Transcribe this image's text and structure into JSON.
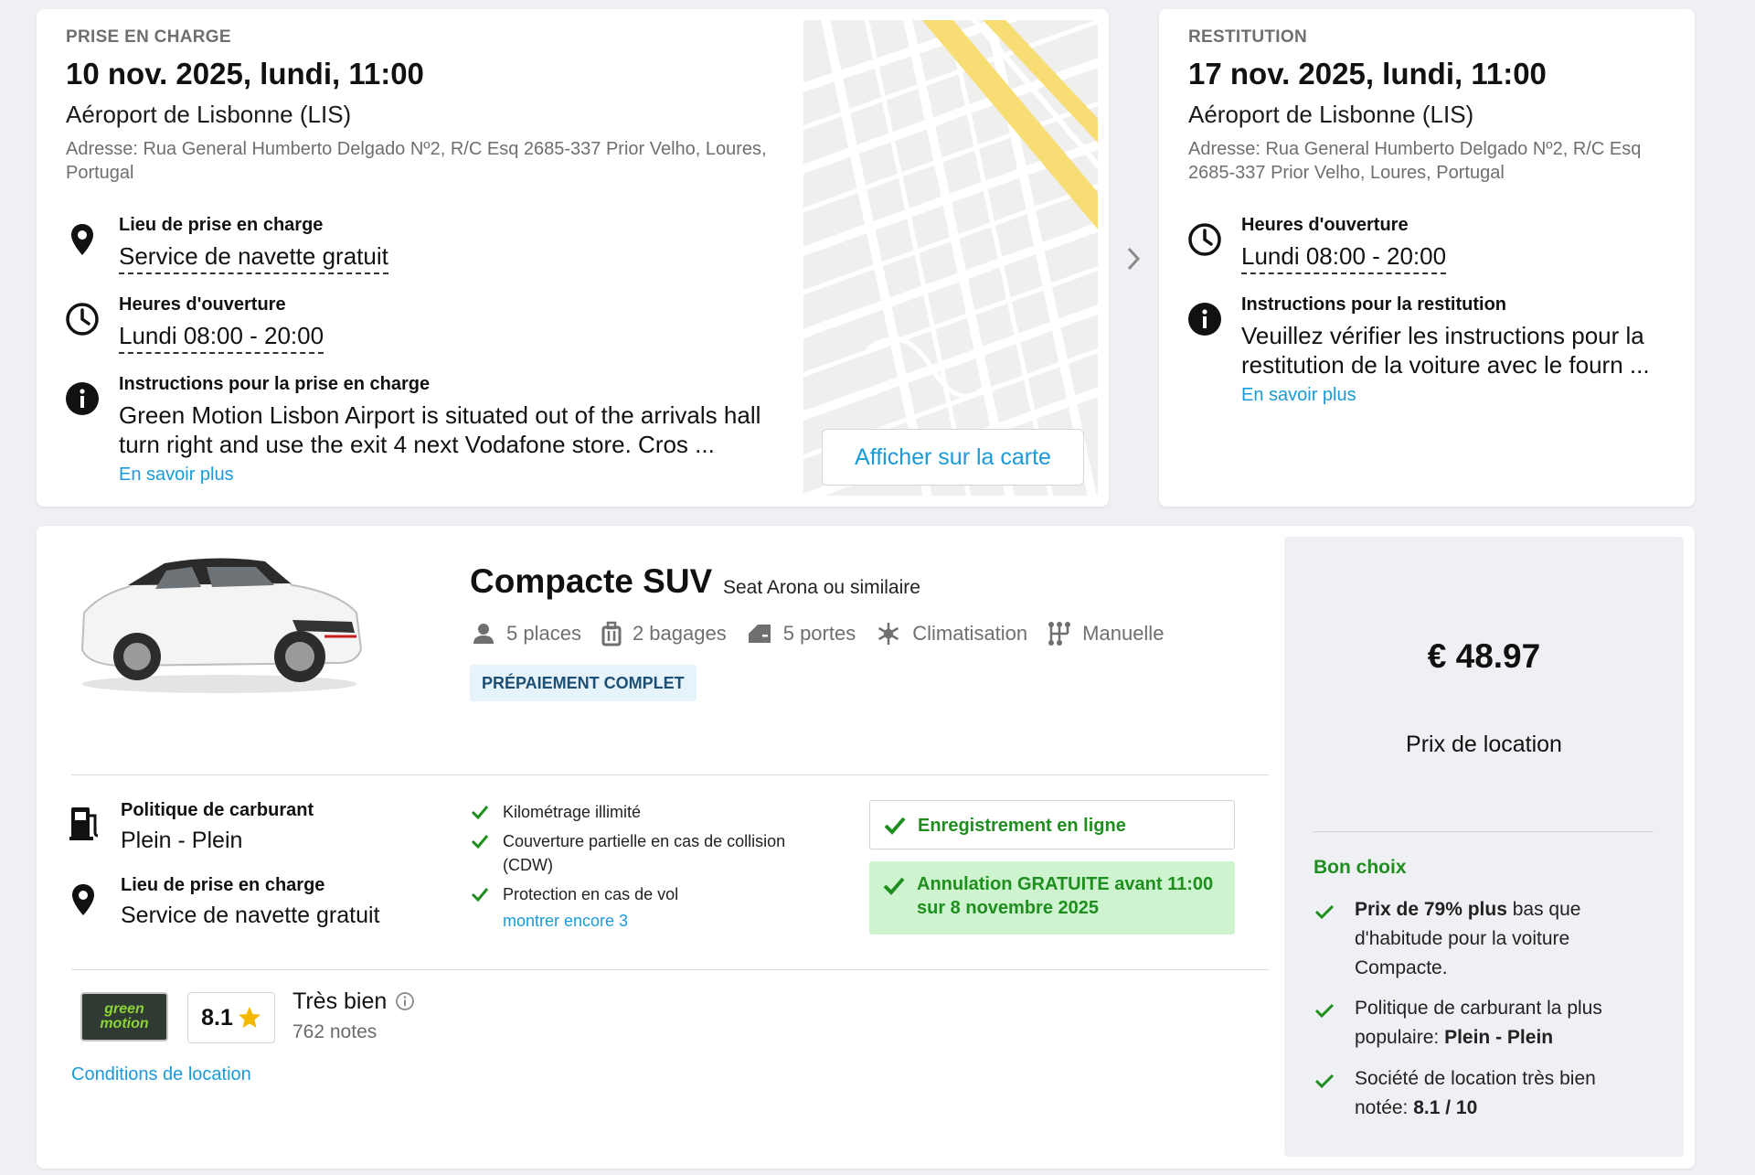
{
  "pickup": {
    "header": "PRISE EN CHARGE",
    "date": "10 nov. 2025, lundi, 11:00",
    "location": "Aéroport de Lisbonne (LIS)",
    "address_line1": "Adresse: Rua General Humberto Delgado Nº2, R/C Esq 2685-337 Prior Velho, Loures,",
    "address_line2": "Portugal",
    "place_label": "Lieu de prise en charge",
    "place_value": "Service de navette gratuit",
    "hours_label": "Heures d'ouverture",
    "hours_value": "Lundi 08:00 - 20:00",
    "instr_label": "Instructions pour la prise en charge",
    "instr_line1": "Green Motion Lisbon Airport is situated out of the arrivals hall",
    "instr_line2": "turn right and use the exit 4 next Vodafone store. Cros ...",
    "more_link": "En savoir plus",
    "map_button": "Afficher sur la carte"
  },
  "dropoff": {
    "header": "RESTITUTION",
    "date": "17 nov. 2025, lundi, 11:00",
    "location": "Aéroport de Lisbonne (LIS)",
    "address_line1": "Adresse: Rua General Humberto Delgado Nº2, R/C Esq",
    "address_line2": "2685-337 Prior Velho, Loures, Portugal",
    "hours_label": "Heures d'ouverture",
    "hours_value": "Lundi 08:00 - 20:00",
    "instr_label": "Instructions pour la restitution",
    "instr_line1": "Veuillez vérifier les instructions pour la",
    "instr_line2": "restitution de la voiture avec le fourn ...",
    "more_link": "En savoir plus"
  },
  "car": {
    "category": "Compacte SUV",
    "model": "Seat Arona ou similaire",
    "features": {
      "seats": "5 places",
      "bags": "2 bagages",
      "doors": "5 portes",
      "ac": "Climatisation",
      "gearbox": "Manuelle"
    },
    "prepay_badge": "PRÉPAIEMENT COMPLET",
    "fuel_label": "Politique de carburant",
    "fuel_value": "Plein - Plein",
    "pickup_label": "Lieu de prise en charge",
    "pickup_value": "Service de navette gratuit",
    "inclusions": {
      "item1": "Kilométrage illimité",
      "item2_l1": "Couverture partielle en cas de collision",
      "item2_l2": "(CDW)",
      "item3": "Protection en cas de vol",
      "more": "montrer encore 3"
    },
    "online_checkin": "Enregistrement en ligne",
    "cancel_l1": "Annulation GRATUITE avant 11:00",
    "cancel_l2": "sur 8 novembre 2025",
    "supplier_logo_text": "green motion",
    "rating_score": "8.1",
    "rating_label": "Très bien",
    "rating_count": "762 notes",
    "conditions_link": "Conditions de location"
  },
  "price": {
    "amount": "€ 48.97",
    "label": "Prix de location",
    "bon_title": "Bon choix",
    "b1_bold": "Prix de 79% plus",
    "b1_rest1": " bas que",
    "b1_l2": "d'habitude pour la voiture",
    "b1_l3": "Compacte.",
    "b2_l1": "Politique de carburant la plus",
    "b2_l2_pre": "populaire: ",
    "b2_l2_bold": "Plein - Plein",
    "b3_l1": "Société de location très bien",
    "b3_l2_pre": "notée: ",
    "b3_l2_bold": "8.1 / 10"
  },
  "colors": {
    "accent_blue": "#1a9bd7",
    "green": "#1e8e1e",
    "green_bg": "#cdf3cf",
    "badge_bg": "#e6f3fa",
    "star": "#f5b800"
  }
}
